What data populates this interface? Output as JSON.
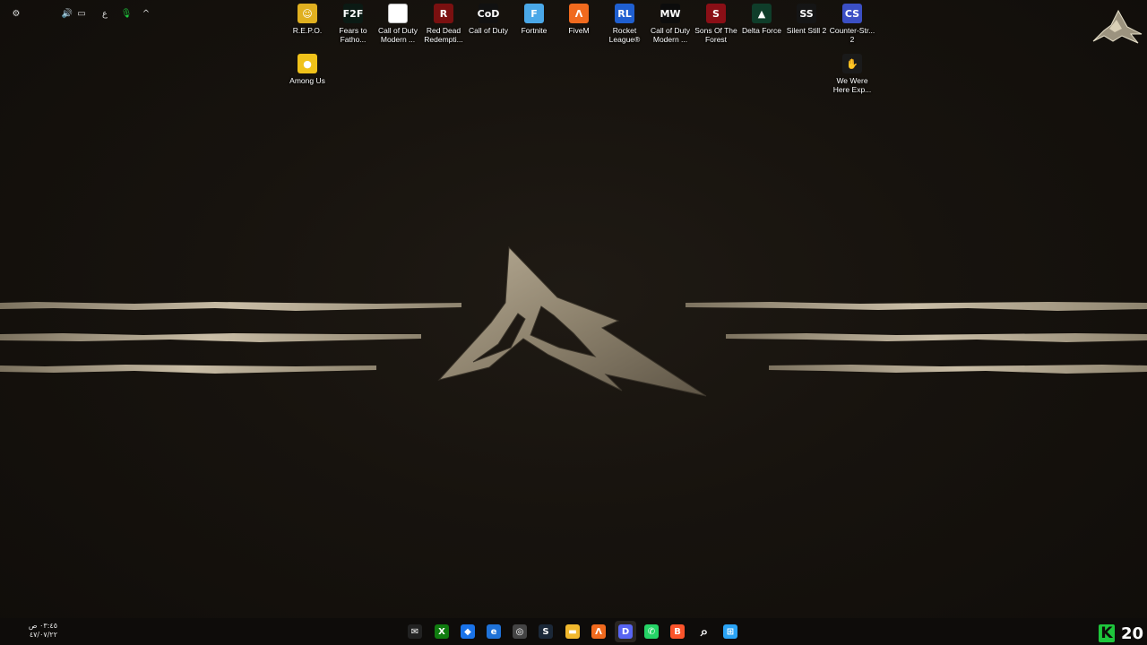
{
  "desktop": {
    "icons": [
      {
        "label": "R.E.P.O.",
        "icon": "repo-game-icon",
        "color": "#e0b020",
        "glyph": "☺"
      },
      {
        "label": "Fears to Fatho...",
        "icon": "fears-to-fathom-icon",
        "color": "#0b1a14",
        "glyph": "F2F"
      },
      {
        "label": "Call of Duty Modern ...",
        "icon": "file-shortcut-icon",
        "color": "#ffffff",
        "glyph": ""
      },
      {
        "label": "Red Dead Redempti...",
        "icon": "red-dead-redemption-icon",
        "color": "#7a1010",
        "glyph": "R"
      },
      {
        "label": "Call of Duty",
        "icon": "call-of-duty-icon",
        "color": "#111111",
        "glyph": "CoD"
      },
      {
        "label": "Fortnite",
        "icon": "fortnite-icon",
        "color": "#4aa8e8",
        "glyph": "F"
      },
      {
        "label": "FiveM",
        "icon": "fivem-icon",
        "color": "#f06a1e",
        "glyph": "Λ"
      },
      {
        "label": "Rocket League®",
        "icon": "rocket-league-icon",
        "color": "#1f5fd0",
        "glyph": "RL"
      },
      {
        "label": "Call of Duty Modern ...",
        "icon": "call-of-duty-mw-icon",
        "color": "#0c0c0c",
        "glyph": "MW"
      },
      {
        "label": "Sons Of The Forest",
        "icon": "sons-of-the-forest-icon",
        "color": "#8a0f16",
        "glyph": "S"
      },
      {
        "label": "Delta Force",
        "icon": "delta-force-icon",
        "color": "#0f3d2a",
        "glyph": "▲"
      },
      {
        "label": "Silent Still 2",
        "icon": "silent-still-icon",
        "color": "#151515",
        "glyph": "SS"
      },
      {
        "label": "Counter-Str... 2",
        "icon": "counter-strike-icon",
        "color": "#3b4fc4",
        "glyph": "CS"
      },
      {
        "label": "Among Us",
        "icon": "among-us-icon",
        "color": "#f0c21a",
        "glyph": "●"
      },
      {
        "label": "We Were Here Exp...",
        "icon": "we-were-here-icon",
        "color": "#1a1a1a",
        "glyph": "✋"
      }
    ]
  },
  "taskbar": {
    "apps": [
      {
        "name": "mail-app-icon",
        "color": "#222222",
        "glyph": "✉"
      },
      {
        "name": "xbox-icon",
        "color": "#107c10",
        "glyph": "X"
      },
      {
        "name": "shield-app-icon",
        "color": "#1a73e8",
        "glyph": "◆"
      },
      {
        "name": "edge-browser-icon",
        "color": "#1f72d8",
        "glyph": "e"
      },
      {
        "name": "game-launcher-icon",
        "color": "#444444",
        "glyph": "◎"
      },
      {
        "name": "steam-icon",
        "color": "#1b2838",
        "glyph": "S"
      },
      {
        "name": "file-explorer-icon",
        "color": "#f1b82d",
        "glyph": "▬"
      },
      {
        "name": "fivem-taskbar-icon",
        "color": "#f06a1e",
        "glyph": "Λ"
      },
      {
        "name": "discord-icon",
        "color": "#5865f2",
        "glyph": "D"
      },
      {
        "name": "whatsapp-icon",
        "color": "#25d366",
        "glyph": "✆"
      },
      {
        "name": "brave-browser-icon",
        "color": "#fb542b",
        "glyph": "B"
      },
      {
        "name": "search-icon",
        "color": "#0e0c0a",
        "glyph": "⌕"
      },
      {
        "name": "start-menu-icon",
        "color": "#2aa3f5",
        "glyph": "⊞"
      }
    ],
    "tray": {
      "chevron": "^",
      "mic": "🎙",
      "language": "ع",
      "network": "▭",
      "volume": "🔊",
      "time": "٠٣:٤٥ ص",
      "date": "٤٧/٠٧/٢٢"
    },
    "widget": {
      "logo": "K",
      "score": "20"
    }
  },
  "colors": {
    "wallpaper_dark": "#17130e",
    "metal_light": "#c9bda6",
    "metal_dark": "#6a6050",
    "taskbar": "#0e0c0a",
    "accent_green": "#1ec63c"
  }
}
